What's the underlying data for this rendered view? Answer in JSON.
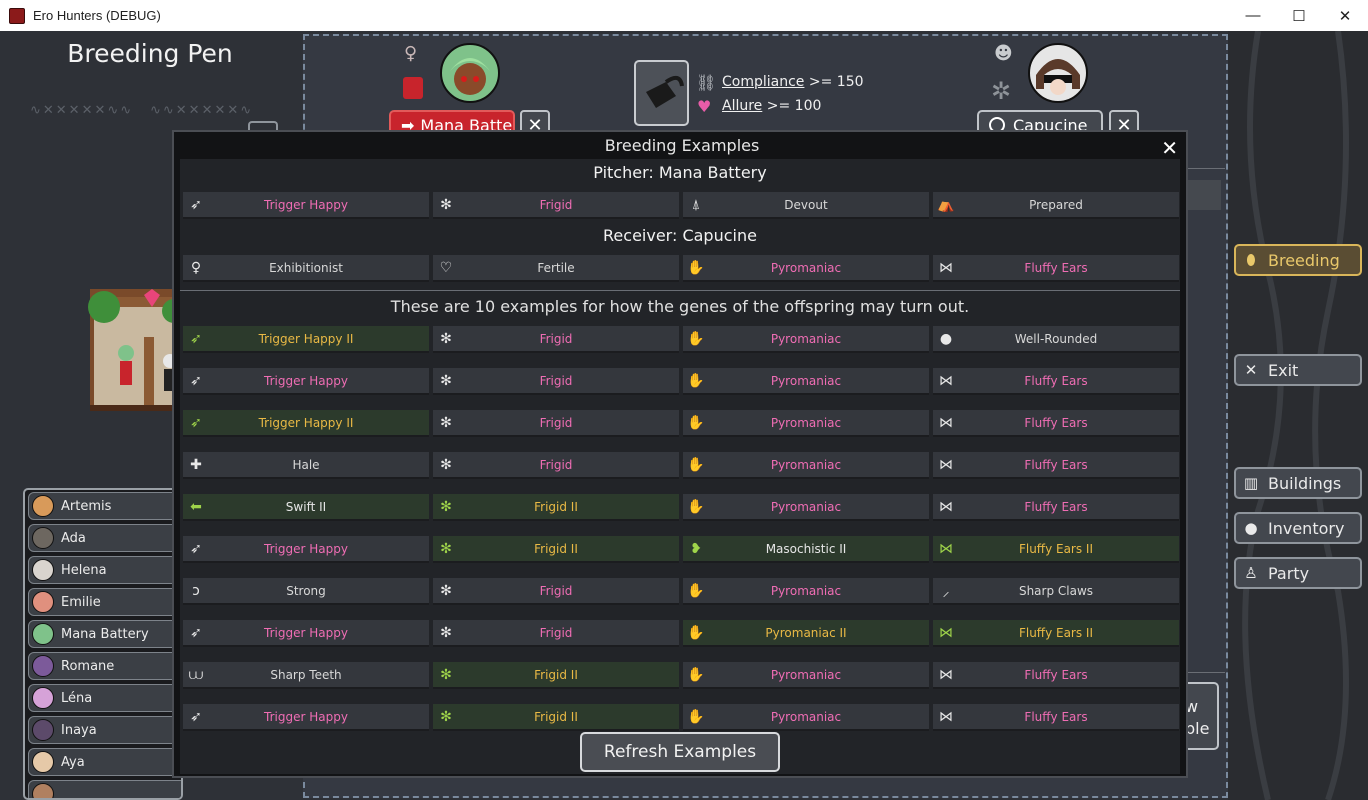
{
  "window": {
    "title": "Ero Hunters (DEBUG)",
    "minimize": "—",
    "maximize": "☐",
    "close": "✕"
  },
  "left": {
    "title": "Breeding Pen",
    "characters": [
      {
        "name": "Artemis",
        "color": "#d89a5a"
      },
      {
        "name": "Ada",
        "color": "#6d6760"
      },
      {
        "name": "Helena",
        "color": "#d9d4ce"
      },
      {
        "name": "Emilie",
        "color": "#e0907e"
      },
      {
        "name": "Mana Battery",
        "color": "#7fc28a"
      },
      {
        "name": "Romane",
        "color": "#7c5a9a"
      },
      {
        "name": "Léna",
        "color": "#d6a2d8"
      },
      {
        "name": "Inaya",
        "color": "#5c4a6a"
      },
      {
        "name": "Aya",
        "color": "#e6c9a8"
      }
    ]
  },
  "pitcher_select": {
    "label": "Mana Batte",
    "close": "✕"
  },
  "receiver_select": {
    "label": "Capucine",
    "close": "✕"
  },
  "requirements": [
    {
      "stat": "Compliance",
      "rest": " >= 150",
      "icon": "chain-icon"
    },
    {
      "stat": "Allure",
      "rest": " >= 100",
      "icon": "lips-icon"
    }
  ],
  "right_menu": {
    "breeding": "Breeding",
    "exit": "Exit",
    "buildings": "Buildings",
    "inventory": "Inventory",
    "party": "Party"
  },
  "behind_text": {
    "line1": "w",
    "line2": "ple"
  },
  "modal": {
    "title": "Breeding Examples",
    "close": "✕",
    "pitcher_heading": "Pitcher: Mana Battery",
    "pitcher_genes": [
      {
        "name": "Trigger Happy",
        "style": "pink",
        "icon": "gun-icon"
      },
      {
        "name": "Frigid",
        "style": "pink",
        "icon": "snowflake-icon"
      },
      {
        "name": "Devout",
        "style": "normal",
        "icon": "praying-hands-icon"
      },
      {
        "name": "Prepared",
        "style": "normal",
        "icon": "tent-icon"
      }
    ],
    "receiver_heading": "Receiver: Capucine",
    "receiver_genes": [
      {
        "name": "Exhibitionist",
        "style": "normal",
        "icon": "figure-icon"
      },
      {
        "name": "Fertile",
        "style": "normal",
        "icon": "heart-icon"
      },
      {
        "name": "Pyromaniac",
        "style": "pink",
        "icon": "fire-hand-icon"
      },
      {
        "name": "Fluffy Ears",
        "style": "pink",
        "icon": "ears-icon"
      }
    ],
    "examples_heading": "These are 10 examples for how the genes of the offspring may turn out.",
    "examples": [
      [
        {
          "name": "Trigger Happy II",
          "style": "up",
          "icon": "gun-icon"
        },
        {
          "name": "Frigid",
          "style": "pink",
          "icon": "snowflake-icon"
        },
        {
          "name": "Pyromaniac",
          "style": "pink",
          "icon": "fire-hand-icon"
        },
        {
          "name": "Well-Rounded",
          "style": "normal",
          "icon": "circle-icon"
        }
      ],
      [
        {
          "name": "Trigger Happy",
          "style": "pink",
          "icon": "gun-icon"
        },
        {
          "name": "Frigid",
          "style": "pink",
          "icon": "snowflake-icon"
        },
        {
          "name": "Pyromaniac",
          "style": "pink",
          "icon": "fire-hand-icon"
        },
        {
          "name": "Fluffy Ears",
          "style": "pink",
          "icon": "ears-icon"
        }
      ],
      [
        {
          "name": "Trigger Happy II",
          "style": "up",
          "icon": "gun-icon"
        },
        {
          "name": "Frigid",
          "style": "pink",
          "icon": "snowflake-icon"
        },
        {
          "name": "Pyromaniac",
          "style": "pink",
          "icon": "fire-hand-icon"
        },
        {
          "name": "Fluffy Ears",
          "style": "pink",
          "icon": "ears-icon"
        }
      ],
      [
        {
          "name": "Hale",
          "style": "normal",
          "icon": "cross-icon"
        },
        {
          "name": "Frigid",
          "style": "pink",
          "icon": "snowflake-icon"
        },
        {
          "name": "Pyromaniac",
          "style": "pink",
          "icon": "fire-hand-icon"
        },
        {
          "name": "Fluffy Ears",
          "style": "pink",
          "icon": "ears-icon"
        }
      ],
      [
        {
          "name": "Swift II",
          "style": "up-white",
          "icon": "arrow-icon"
        },
        {
          "name": "Frigid II",
          "style": "up",
          "icon": "snowflake-icon"
        },
        {
          "name": "Pyromaniac",
          "style": "pink",
          "icon": "fire-hand-icon"
        },
        {
          "name": "Fluffy Ears",
          "style": "pink",
          "icon": "ears-icon"
        }
      ],
      [
        {
          "name": "Trigger Happy",
          "style": "pink",
          "icon": "gun-icon"
        },
        {
          "name": "Frigid II",
          "style": "up",
          "icon": "snowflake-icon"
        },
        {
          "name": "Masochistic II",
          "style": "up-white",
          "icon": "broken-heart-icon"
        },
        {
          "name": "Fluffy Ears II",
          "style": "up",
          "icon": "ears-icon"
        }
      ],
      [
        {
          "name": "Strong",
          "style": "normal",
          "icon": "arm-icon"
        },
        {
          "name": "Frigid",
          "style": "pink",
          "icon": "snowflake-icon"
        },
        {
          "name": "Pyromaniac",
          "style": "pink",
          "icon": "fire-hand-icon"
        },
        {
          "name": "Sharp Claws",
          "style": "normal",
          "icon": "claw-icon"
        }
      ],
      [
        {
          "name": "Trigger Happy",
          "style": "pink",
          "icon": "gun-icon"
        },
        {
          "name": "Frigid",
          "style": "pink",
          "icon": "snowflake-icon"
        },
        {
          "name": "Pyromaniac II",
          "style": "up",
          "icon": "fire-hand-icon"
        },
        {
          "name": "Fluffy Ears II",
          "style": "up",
          "icon": "ears-icon"
        }
      ],
      [
        {
          "name": "Sharp Teeth",
          "style": "normal",
          "icon": "teeth-icon"
        },
        {
          "name": "Frigid II",
          "style": "up",
          "icon": "snowflake-icon"
        },
        {
          "name": "Pyromaniac",
          "style": "pink",
          "icon": "fire-hand-icon"
        },
        {
          "name": "Fluffy Ears",
          "style": "pink",
          "icon": "ears-icon"
        }
      ],
      [
        {
          "name": "Trigger Happy",
          "style": "pink",
          "icon": "gun-icon"
        },
        {
          "name": "Frigid II",
          "style": "up",
          "icon": "snowflake-icon"
        },
        {
          "name": "Pyromaniac",
          "style": "pink",
          "icon": "fire-hand-icon"
        },
        {
          "name": "Fluffy Ears",
          "style": "pink",
          "icon": "ears-icon"
        }
      ]
    ],
    "refresh_label": "Refresh Examples"
  },
  "colors": {
    "pink_gene": "#ef6db4",
    "upgraded_gene": "#e9b945",
    "upgraded_icon": "#9fd44a",
    "breeding_active": "#e9c86a",
    "pitcher_button": "#c8242c"
  }
}
